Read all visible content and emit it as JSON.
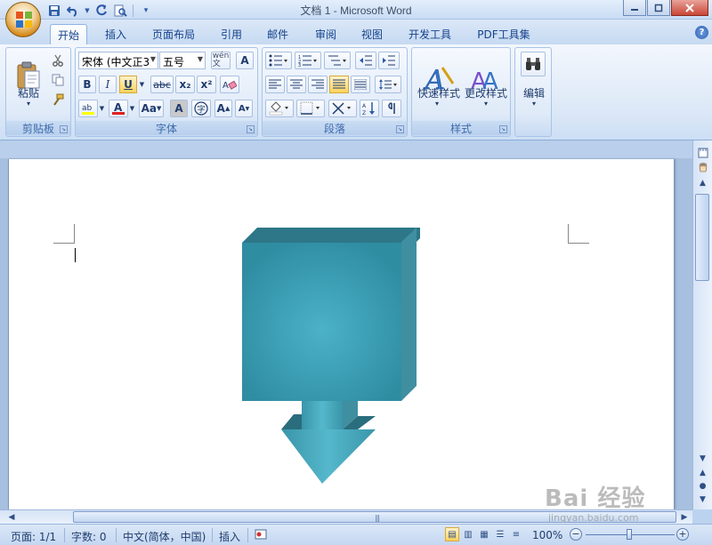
{
  "window": {
    "title": "文档 1 - Microsoft Word",
    "quick_access": [
      "save-icon",
      "undo-icon",
      "redo-icon",
      "print-preview-icon",
      "customize-icon"
    ]
  },
  "tabs": [
    "开始",
    "插入",
    "页面布局",
    "引用",
    "邮件",
    "审阅",
    "视图",
    "开发工具",
    "PDF工具集"
  ],
  "active_tab": "开始",
  "ribbon": {
    "clipboard": {
      "label": "剪贴板",
      "paste_label": "粘贴"
    },
    "font": {
      "label": "字体",
      "font_name": "宋体 (中文正3",
      "font_size": "五号",
      "bold": "B",
      "italic": "I",
      "underline": "U",
      "strikethrough": "abc",
      "subscript": "x₂",
      "superscript": "x²",
      "grow": "A",
      "shrink": "A",
      "change_case": "Aa",
      "font_color": "A",
      "char_shading": "A",
      "enclosed": "字",
      "phonetic": "wén\n文"
    },
    "paragraph": {
      "label": "段落"
    },
    "styles": {
      "label": "样式",
      "quick_styles": "快速样式",
      "change_styles": "更改样式"
    },
    "editing": {
      "label": "编辑"
    }
  },
  "document": {
    "shape": "down-arrow-callout-3d",
    "shape_colors": {
      "front": "#3c9db2",
      "top": "#2d7788",
      "side": "#3f8fa1",
      "shadow": "#2a6d7d"
    }
  },
  "statusbar": {
    "page": "页面: 1/1",
    "words": "字数: 0",
    "language": "中文(简体，中国)",
    "mode": "插入",
    "zoom": "100%"
  },
  "watermark": {
    "main": "Bai 经验",
    "sub": "jingyan.baidu.com"
  }
}
